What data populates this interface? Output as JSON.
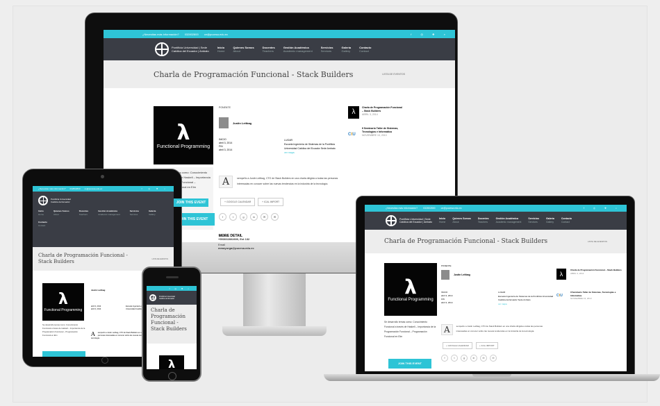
{
  "topbar": {
    "question": "¿Necesitas más información?",
    "phone": "032802800",
    "email": "ce@pucesa.edu.ec"
  },
  "brand": {
    "line1": "Pontificia Universidad",
    "line2": "Católica del Ecuador",
    "line3": "Sede",
    "line4": "Ambato"
  },
  "nav": [
    {
      "label": "Inicio",
      "sub": "Home"
    },
    {
      "label": "Quienes Somos",
      "sub": "About"
    },
    {
      "label": "Docentes",
      "sub": "Teachers"
    },
    {
      "label": "Gestión Académica",
      "sub": "Academic management"
    },
    {
      "label": "Servicios",
      "sub": "Services"
    },
    {
      "label": "Galería",
      "sub": "Gallery"
    },
    {
      "label": "Contacto",
      "sub": "Contact"
    }
  ],
  "event": {
    "title": "Charla de Programación Funcional - Stack Builders",
    "back": "LISTA DE EVENTOS",
    "image_caption": "Functional Programming",
    "speaker_label": "PONENTE",
    "speaker": "Justin Leitbag",
    "start_label": "INICIO",
    "start": "abril 3, 2014",
    "end_label": "FIN",
    "end": "abril 3, 2014",
    "place_label": "LUGAR",
    "place": "Escuela Ingeniería de Sistemas de la Pontificia Universidad Católica del Ecuador Sede Ambato",
    "map_link": "ver mapa",
    "description": "Se desarrollo temas como: Conocimiento Funcional a través de Haskell – Importancia de la Programación Funcional – Programación Funcional en Elm",
    "body": "sempeño a Justin Leitbag, CTO de Stack Builders en una charla dirigida a todas las personas interesadas en conocer sobre las nuevas tendencias en la industria de la tecnología.",
    "body_initial": "A",
    "google_btn": "+ GOOGLE CALENDAR",
    "ical_btn": "+ ICAL IMPORT",
    "join_btn": "JOIN THIS EVENT",
    "share": [
      "f",
      "t",
      "g",
      "in",
      "✉",
      "✉"
    ],
    "more_title": "MORE DETAIL",
    "phone_label": "Teléfono",
    "phone_value": "+593032802800, Ext 132",
    "email_label": "Email",
    "email_value": "mmayorga@pucesa.edu.ec"
  },
  "sidebar": [
    {
      "title": "Charla de Programación Funcional – Stack Builders",
      "date": "ABRIL 3, 2014"
    },
    {
      "title": "II Seminario Taller de Sistemas, Tecnologías e Informática",
      "date": "NOVIEMBRE 13, 2013"
    }
  ]
}
